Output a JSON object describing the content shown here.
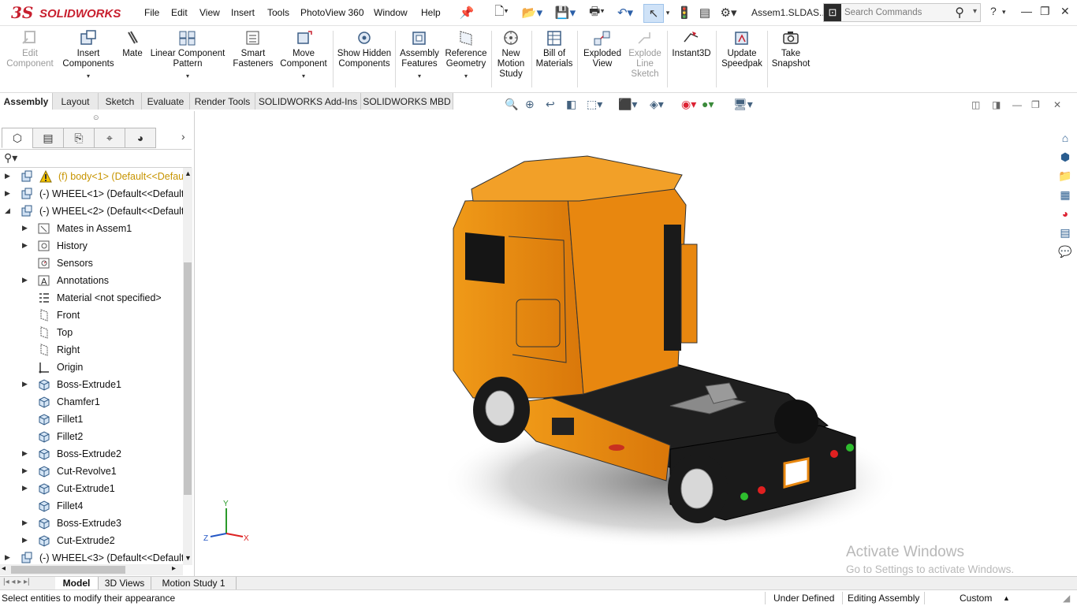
{
  "app": {
    "brand": "SOLIDWORKS",
    "brand_prefix": "3S",
    "filename": "Assem1.SLDAS..."
  },
  "menu": [
    "File",
    "Edit",
    "View",
    "Insert",
    "Tools",
    "PhotoView 360",
    "Window",
    "Help"
  ],
  "search": {
    "placeholder": "Search Commands"
  },
  "commands": {
    "edit_component": "Edit Component",
    "insert_components": "Insert Components",
    "mate": "Mate",
    "linear_pattern": "Linear Component Pattern",
    "smart_fasteners": "Smart Fasteners",
    "move_component": "Move Component",
    "show_hidden": "Show Hidden Components",
    "assembly_features": "Assembly Features",
    "reference_geometry": "Reference Geometry",
    "new_motion_study": "New Motion Study",
    "bill_of_materials": "Bill of Materials",
    "exploded_view": "Exploded View",
    "explode_line_sketch": "Explode Line Sketch",
    "instant3d": "Instant3D",
    "update_speedpak": "Update Speedpak",
    "take_snapshot": "Take Snapshot"
  },
  "cmd_tabs": [
    "Assembly",
    "Layout",
    "Sketch",
    "Evaluate",
    "Render Tools",
    "SOLIDWORKS Add-Ins",
    "SOLIDWORKS MBD"
  ],
  "tree": [
    {
      "label": "(f) body<1> (Default<<Defaul",
      "icon": "warning-icon",
      "expand": "collapsed",
      "indent": 0,
      "warn": true
    },
    {
      "label": "(-) WHEEL<1> (Default<<Default>",
      "icon": "part-icon",
      "expand": "collapsed",
      "indent": 0
    },
    {
      "label": "(-) WHEEL<2> (Default<<Default>",
      "icon": "part-icon",
      "expand": "expanded",
      "indent": 0
    },
    {
      "label": "Mates in Assem1",
      "icon": "mates-icon",
      "expand": "collapsed",
      "indent": 1
    },
    {
      "label": "History",
      "icon": "history-icon",
      "expand": "collapsed",
      "indent": 1
    },
    {
      "label": "Sensors",
      "icon": "sensor-icon",
      "expand": "none",
      "indent": 1
    },
    {
      "label": "Annotations",
      "icon": "annotation-icon",
      "expand": "collapsed",
      "indent": 1
    },
    {
      "label": "Material <not specified>",
      "icon": "material-icon",
      "expand": "none",
      "indent": 1
    },
    {
      "label": "Front",
      "icon": "plane-icon",
      "expand": "none",
      "indent": 1
    },
    {
      "label": "Top",
      "icon": "plane-icon",
      "expand": "none",
      "indent": 1
    },
    {
      "label": "Right",
      "icon": "plane-icon",
      "expand": "none",
      "indent": 1
    },
    {
      "label": "Origin",
      "icon": "origin-icon",
      "expand": "none",
      "indent": 1
    },
    {
      "label": "Boss-Extrude1",
      "icon": "feature-icon",
      "expand": "collapsed",
      "indent": 1
    },
    {
      "label": "Chamfer1",
      "icon": "feature-icon",
      "expand": "none",
      "indent": 1
    },
    {
      "label": "Fillet1",
      "icon": "feature-icon",
      "expand": "none",
      "indent": 1
    },
    {
      "label": "Fillet2",
      "icon": "feature-icon",
      "expand": "none",
      "indent": 1
    },
    {
      "label": "Boss-Extrude2",
      "icon": "feature-icon",
      "expand": "collapsed",
      "indent": 1
    },
    {
      "label": "Cut-Revolve1",
      "icon": "feature-icon",
      "expand": "collapsed",
      "indent": 1
    },
    {
      "label": "Cut-Extrude1",
      "icon": "feature-icon",
      "expand": "collapsed",
      "indent": 1
    },
    {
      "label": "Fillet4",
      "icon": "feature-icon",
      "expand": "none",
      "indent": 1
    },
    {
      "label": "Boss-Extrude3",
      "icon": "feature-icon",
      "expand": "collapsed",
      "indent": 1
    },
    {
      "label": "Cut-Extrude2",
      "icon": "feature-icon",
      "expand": "collapsed",
      "indent": 1
    },
    {
      "label": "(-) WHEEL<3> (Default<<Default>",
      "icon": "part-icon",
      "expand": "collapsed",
      "indent": 0
    }
  ],
  "bottom_tabs": [
    "Model",
    "3D Views",
    "Motion Study 1"
  ],
  "status": {
    "message": "Select entities to modify their appearance",
    "state": "Under Defined",
    "mode": "Editing Assembly",
    "units": "Custom"
  },
  "triad": {
    "y": "Y",
    "x": "X",
    "z": "Z"
  },
  "watermark": {
    "line1": "Activate Windows",
    "line2": "Go to Settings to activate Windows."
  },
  "colors": {
    "truck_body": "#e8870f",
    "chassis": "#1c1c1c",
    "accent_red": "#c8202f",
    "accent_brand": "#c8202f"
  }
}
